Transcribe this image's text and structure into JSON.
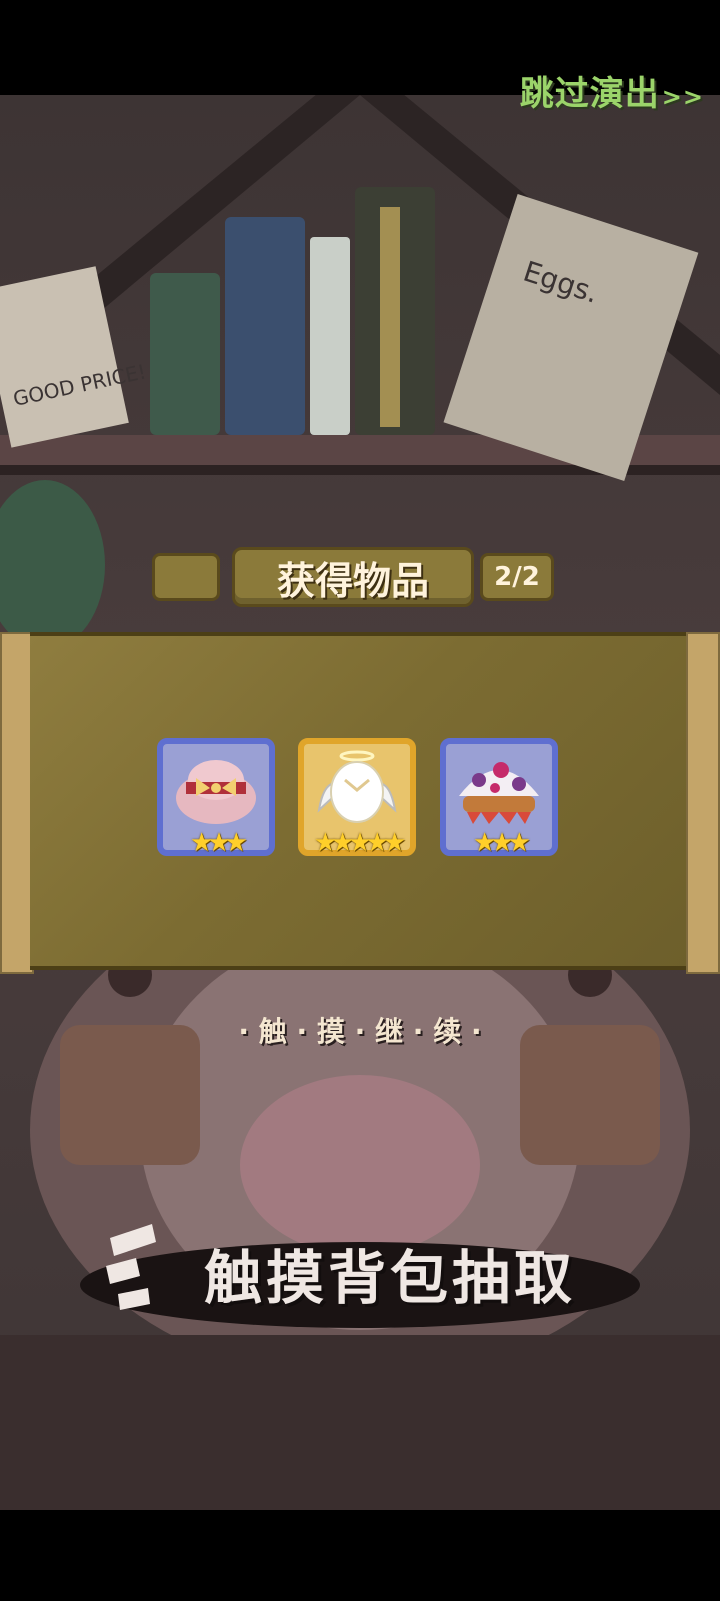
{
  "skip": {
    "label": "跳过演出",
    "arrows": ">>"
  },
  "header": {
    "title": "获得物品",
    "page": "2/2"
  },
  "items": [
    {
      "name": "pink-bow-hat",
      "stars": "★★★",
      "frame": "blue"
    },
    {
      "name": "angel-egg",
      "stars": "★★★★★",
      "frame": "gold"
    },
    {
      "name": "purple-mushroom",
      "stars": "★★★",
      "frame": "blue"
    }
  ],
  "continue_text": "· 触 · 摸 · 继 · 续 ·",
  "touch_bag_text": "触摸背包抽取",
  "background": {
    "note_left": "GOOD PRICE!",
    "note_right": "Eggs."
  }
}
